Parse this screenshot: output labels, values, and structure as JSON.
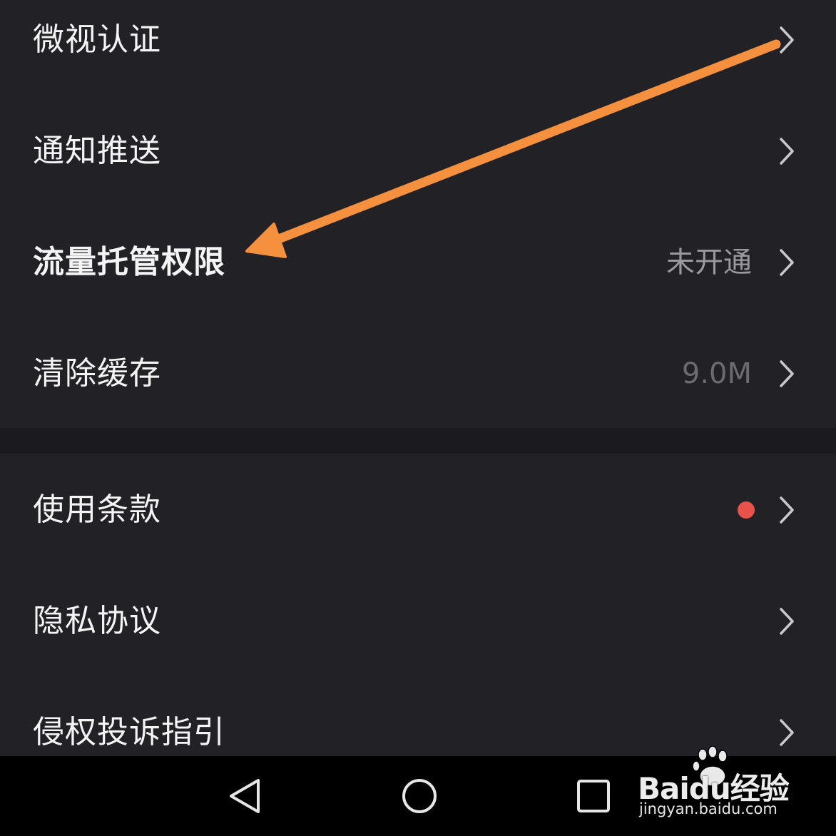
{
  "settings": {
    "group1": [
      {
        "label": "微视认证",
        "value": "",
        "bold": false
      },
      {
        "label": "通知推送",
        "value": "",
        "bold": false
      },
      {
        "label": "流量托管权限",
        "value": "未开通",
        "bold": true
      },
      {
        "label": "清除缓存",
        "value": "9.0M",
        "bold": false
      }
    ],
    "group2": [
      {
        "label": "使用条款",
        "value": "",
        "badge": "red-dot"
      },
      {
        "label": "隐私协议",
        "value": ""
      },
      {
        "label": "侵权投诉指引",
        "value": ""
      }
    ]
  },
  "annotation": {
    "type": "arrow",
    "color": "#f5913e",
    "points_to": "流量托管权限"
  },
  "navbar": {
    "buttons": [
      "back-icon",
      "home-icon",
      "recents-icon"
    ]
  },
  "watermark": {
    "brand_prefix": "Bai",
    "brand_mid": "du",
    "brand_suffix": "经验",
    "url": "jingyan.baidu.com"
  },
  "colors": {
    "background": "#222126",
    "divider": "#1b1a1e",
    "text": "#f4f4f4",
    "secondary_text": "#9a9a9e",
    "badge": "#e8524a",
    "arrow": "#f5913e"
  }
}
